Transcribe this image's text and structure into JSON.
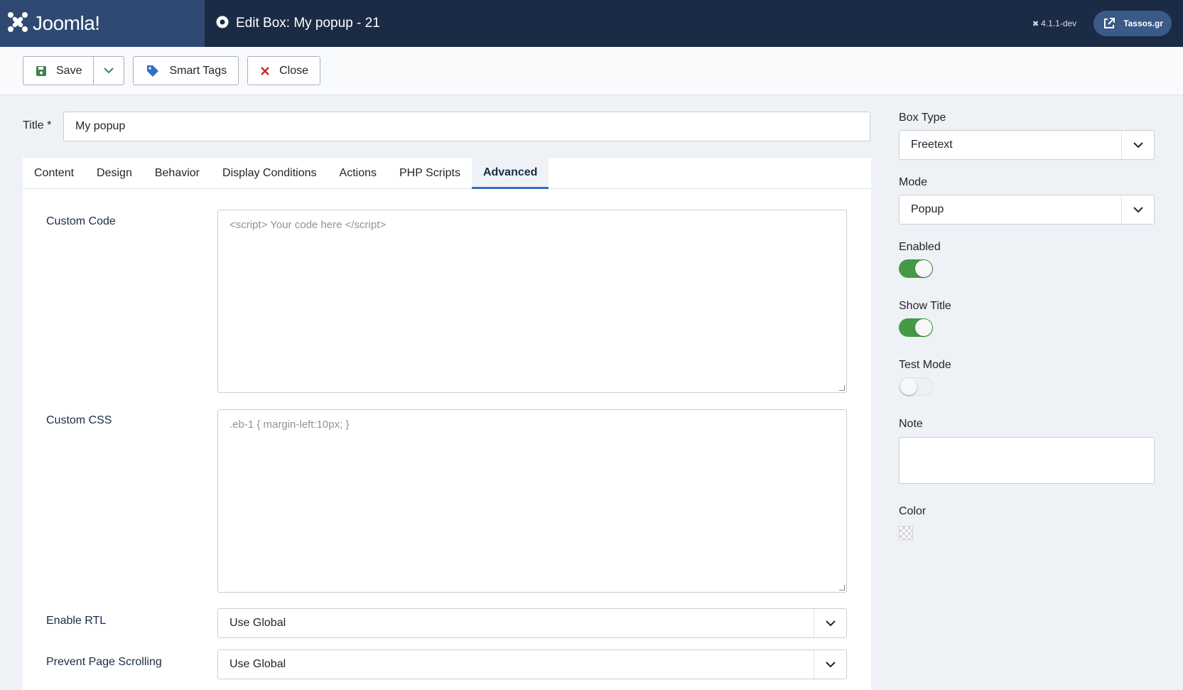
{
  "header": {
    "logo": "Joomla!",
    "page_title": "Edit Box: My popup - 21",
    "version": "4.1.1-dev",
    "site_link": "Tassos.gr"
  },
  "toolbar": {
    "save_label": "Save",
    "smart_tags_label": "Smart Tags",
    "close_label": "Close"
  },
  "form": {
    "title_label": "Title *",
    "title_value": "My popup"
  },
  "tabs": [
    {
      "label": "Content",
      "active": false
    },
    {
      "label": "Design",
      "active": false
    },
    {
      "label": "Behavior",
      "active": false
    },
    {
      "label": "Display Conditions",
      "active": false
    },
    {
      "label": "Actions",
      "active": false
    },
    {
      "label": "PHP Scripts",
      "active": false
    },
    {
      "label": "Advanced",
      "active": true
    }
  ],
  "advanced": {
    "custom_code_label": "Custom Code",
    "custom_code_placeholder": "<script> Your code here </script>",
    "custom_css_label": "Custom CSS",
    "custom_css_placeholder": ".eb-1 { margin-left:10px; }",
    "enable_rtl_label": "Enable RTL",
    "enable_rtl_value": "Use Global",
    "prevent_scroll_label": "Prevent Page Scrolling",
    "prevent_scroll_value": "Use Global"
  },
  "sidebar": {
    "box_type_label": "Box Type",
    "box_type_value": "Freetext",
    "mode_label": "Mode",
    "mode_value": "Popup",
    "enabled_label": "Enabled",
    "enabled": true,
    "show_title_label": "Show Title",
    "show_title": true,
    "test_mode_label": "Test Mode",
    "test_mode": false,
    "note_label": "Note",
    "note_value": "",
    "color_label": "Color"
  },
  "colors": {
    "header_bg": "#1c2b45",
    "logo_bg": "#2e4a73",
    "accent": "#3071c3",
    "toggle_on": "#459a47",
    "close_icon": "#c52827",
    "save_icon": "#457d54"
  }
}
